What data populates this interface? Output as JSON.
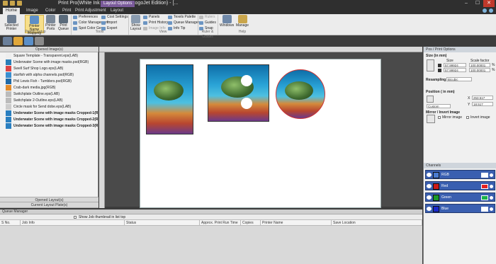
{
  "window": {
    "title": "Print Pro(White Ink Graphics Arts LogoJet Edition) - [...",
    "controls": [
      "–",
      "☐",
      "✕"
    ]
  },
  "tabs": [
    "Home",
    "Image",
    "Color",
    "Print",
    "Print Adjustment",
    "Layout"
  ],
  "context_tab": "Layout Options",
  "ribbon": {
    "big_buttons": [
      "Selected Printer",
      "Printer Name Mapping",
      "Printer Ports",
      "Print Queue",
      "Show Layout",
      "Windows",
      "Manage"
    ],
    "small": {
      "preferences": "Preferences",
      "color_management": "Color Management",
      "spot_color_gen": "Spot Color Gen",
      "cost_settings": "Cost Settings",
      "import": "Import",
      "export": "Export",
      "panels": "Panels",
      "print_history": "Print History",
      "image_info": "Image Info",
      "texels_palette": "Texels Palette",
      "queue_manager": "Queue Manager",
      "info_tip": "Info Tip",
      "rulers": "Rulers",
      "guides": "Guides",
      "snap": "Snap"
    },
    "groups": [
      "Printer Setup",
      "Tools",
      "View",
      "Ruler & Guides",
      "Help"
    ]
  },
  "left_panel": {
    "header": "Opened Image(s)",
    "side_tab": "Opened Images",
    "images": [
      {
        "name": "Square Template - Transparent.eps(LAB)",
        "bold": false
      },
      {
        "name": "Underwater Scene with image masks.psd(RGB)",
        "bold": false
      },
      {
        "name": "Swell Surf Shop Logo.eps(LAB)",
        "bold": false
      },
      {
        "name": "starfish with alpha channels.psd(RGB)",
        "bold": false
      },
      {
        "name": "Phil Lewis Fish - Tumblers.psd(RGB)",
        "bold": false
      },
      {
        "name": "Crab-dark media.jpg(RGB)",
        "bold": false
      },
      {
        "name": "Switchplate Outline.eps(LAB)",
        "bold": false
      },
      {
        "name": "Switchplate 2-Outline.eps(LAB)",
        "bold": false
      },
      {
        "name": "Circle mask for Send dobe.eps(LAB)",
        "bold": false
      },
      {
        "name": "Underwater Scene with image masks Cropped-1(RGB)",
        "bold": true
      },
      {
        "name": "Underwater Scene with image masks Cropped-2(RGB)",
        "bold": true
      },
      {
        "name": "Underwater Scene with image masks Cropped-3(RGB)",
        "bold": true
      }
    ],
    "opened_layouts": "Opened Layout(s)",
    "current_layout": "Current Layout Plate(s)"
  },
  "queue": {
    "title": "Queue Manager",
    "checkbox_label": "Show Job thumbnail in list top",
    "columns": [
      "S No.",
      "Job Info",
      "Status",
      "Approx. Print Run Time",
      "Copies",
      "Printer Name",
      "Save Location"
    ]
  },
  "right_panel": {
    "header": "Pos / Print Options",
    "size_label": "Size (in mm)",
    "size_col": "Size",
    "scale_col": "Scale factor",
    "width_val": "57.99924",
    "height_val": "57.99924",
    "scale_w": "100.00001",
    "scale_h": "100.00001",
    "unit": "%",
    "resampling_label": "Resampling",
    "resampling_value": "Bicubic",
    "position_label": "Position ( in mm)",
    "position_value": "Custom",
    "x_label": "X",
    "y_label": "Y",
    "x_val": "253.517",
    "y_val": "18.517",
    "mirror_label": "Mirror / Invert Image",
    "mirror_image": "Mirror image",
    "invert_image": "Invert image",
    "channels_header": "Channels",
    "channels": [
      {
        "name": "RGB",
        "color": "#4a7bd0"
      },
      {
        "name": "Red",
        "color": "#cc1a1a"
      },
      {
        "name": "Green",
        "color": "#1a9a2a"
      },
      {
        "name": "Blue",
        "color": "#1a2acc"
      }
    ],
    "channel_badge_colors": [
      "#ffffff",
      "#e32020",
      "#19b24a",
      "#ffffff"
    ]
  }
}
